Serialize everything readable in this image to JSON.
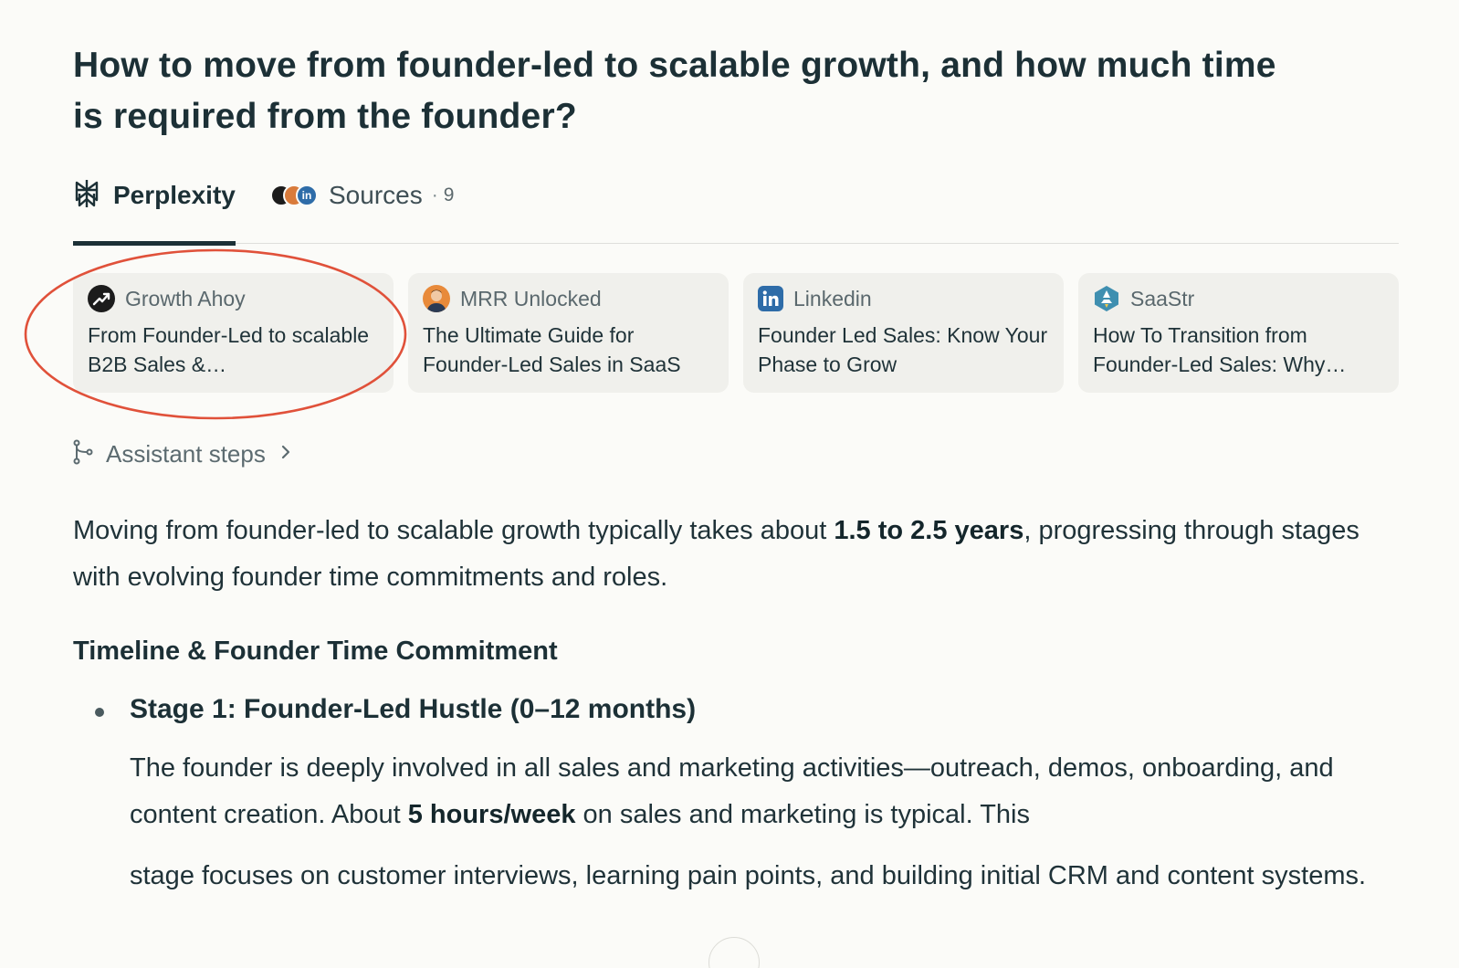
{
  "question": {
    "line1": "How to move from founder-led to scalable growth, and how much time",
    "line2": "is required from the founder?"
  },
  "tabs": {
    "perplexity": "Perplexity",
    "sources": "Sources",
    "separator": "·",
    "sources_count": "9"
  },
  "cards": [
    {
      "source": "Growth Ahoy",
      "title": "From Founder-Led to scalable B2B Sales &…",
      "icon": "growth-chart-icon",
      "circled": true
    },
    {
      "source": "MRR Unlocked",
      "title": "The Ultimate Guide for Founder-Led Sales in SaaS",
      "icon": "avatar-icon"
    },
    {
      "source": "Linkedin",
      "title": "Founder Led Sales: Know Your Phase to Grow",
      "icon": "linkedin-icon"
    },
    {
      "source": "SaaStr",
      "title": "How To Transition from Founder-Led Sales: Why…",
      "icon": "saastr-icon"
    }
  ],
  "assistant_steps": "Assistant steps",
  "answer": {
    "intro_before": "Moving from founder-led to scalable growth typically takes about ",
    "intro_bold": "1.5 to 2.5 years",
    "intro_after": ", progressing through stages with evolving founder time commitments and roles.",
    "heading": "Timeline & Founder Time Commitment",
    "stage1_title": "Stage 1: Founder-Led Hustle (0–12 months)",
    "stage1_p1_before": "The founder is deeply involved in all sales and marketing activities—outreach, demos, onboarding, and content creation. About ",
    "stage1_p1_bold": "5 hours/week",
    "stage1_p1_after": " on sales and marketing is typical. This",
    "stage1_p2": "stage focuses on customer interviews, learning pain points, and building initial CRM and content systems."
  },
  "colors": {
    "background": "#fbfbf8",
    "card_bg": "#f0f0ec",
    "text": "#1f3238",
    "annotation_red": "#e0513a",
    "linkedin_blue": "#2e6ca8",
    "saastr_teal": "#3f8fb0"
  }
}
